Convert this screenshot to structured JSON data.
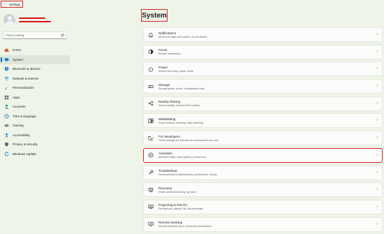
{
  "window": {
    "back_label": "Settings"
  },
  "sidebar": {
    "search_placeholder": "Find a setting",
    "items": [
      {
        "label": "Home",
        "icon": "home-icon",
        "color": "#d35a2b"
      },
      {
        "label": "System",
        "icon": "display-icon",
        "color": "#0078d4",
        "active": true
      },
      {
        "label": "Bluetooth & devices",
        "icon": "bluetooth-icon",
        "color": "#0067c0"
      },
      {
        "label": "Network & internet",
        "icon": "wifi-icon",
        "color": "#1a73c8"
      },
      {
        "label": "Personalization",
        "icon": "brush-icon",
        "color": "#e08a2c"
      },
      {
        "label": "Apps",
        "icon": "apps-icon",
        "color": "#5b6b7a"
      },
      {
        "label": "Accounts",
        "icon": "person-icon",
        "color": "#1e9e6a"
      },
      {
        "label": "Time & language",
        "icon": "globe-clock-icon",
        "color": "#2b7bd3"
      },
      {
        "label": "Gaming",
        "icon": "controller-icon",
        "color": "#6b6b6b"
      },
      {
        "label": "Accessibility",
        "icon": "accessibility-icon",
        "color": "#1f6fc7"
      },
      {
        "label": "Privacy & security",
        "icon": "shield-icon",
        "color": "#5a6673"
      },
      {
        "label": "Windows Update",
        "icon": "update-icon",
        "color": "#0e74c9"
      }
    ]
  },
  "main": {
    "title": "System",
    "items": [
      {
        "title": "Notifications",
        "desc": "Alerts from apps and system, do not disturb",
        "icon": "bell-icon"
      },
      {
        "title": "Focus",
        "desc": "Reduce distractions",
        "icon": "focus-icon"
      },
      {
        "title": "Power",
        "desc": "Screen and sleep, power mode",
        "icon": "power-icon"
      },
      {
        "title": "Storage",
        "desc": "Storage space, drives, configuration rules",
        "icon": "storage-icon"
      },
      {
        "title": "Nearby sharing",
        "desc": "Discoverability, received files location",
        "icon": "share-icon"
      },
      {
        "title": "Multitasking",
        "desc": "Snap windows, desktops, task switching",
        "icon": "multitask-icon"
      },
      {
        "title": "For developers",
        "desc": "These settings are intended for development use only",
        "icon": "developer-icon"
      },
      {
        "title": "Activation",
        "desc": "Activation state, subscriptions, product key",
        "icon": "activation-icon",
        "highlight": true
      },
      {
        "title": "Troubleshoot",
        "desc": "Recommended troubleshooters, preferences, history",
        "icon": "wrench-icon"
      },
      {
        "title": "Recovery",
        "desc": "Reset, advanced startup, go back",
        "icon": "recovery-icon"
      },
      {
        "title": "Projecting to this PC",
        "desc": "Permissions, pairing PIN, discoverability",
        "icon": "projector-icon"
      },
      {
        "title": "Remote Desktop",
        "desc": "Remote Desktop users, connection permissions",
        "icon": "remote-desktop-icon"
      }
    ]
  }
}
